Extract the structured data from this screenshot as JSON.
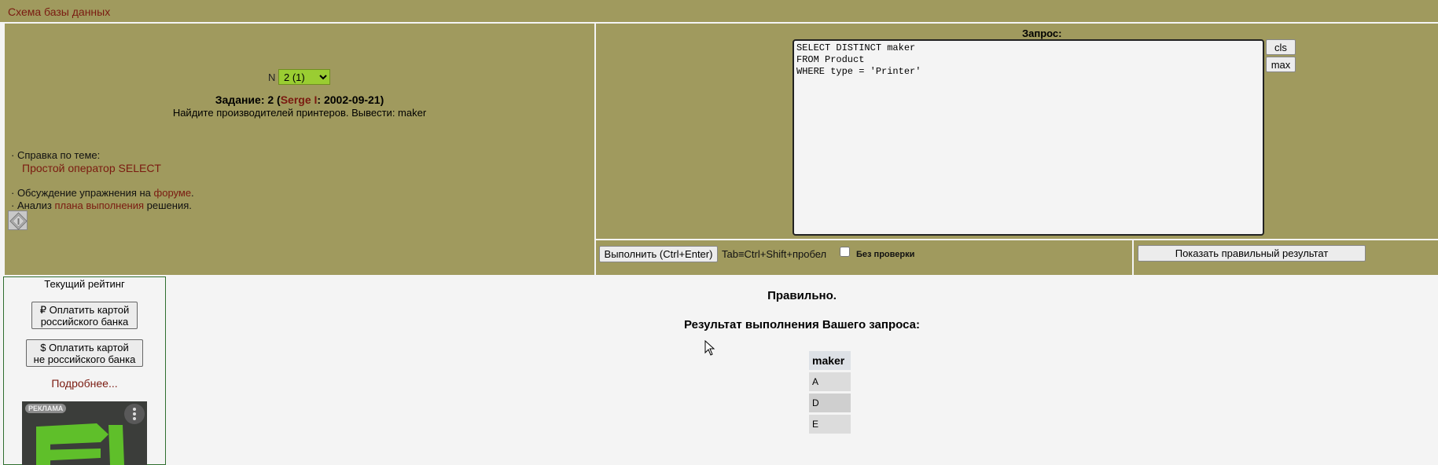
{
  "header": {
    "schema_link": "Схема базы данных"
  },
  "task": {
    "n_label": "N",
    "n_selected": "2 (1)",
    "title_prefix": "Задание: 2 (",
    "author": "Serge I",
    "title_suffix": ": 2002-09-21)",
    "description": "Найдите производителей принтеров. Вывести: maker",
    "help_label": "· Справка по теме:",
    "help_link": "Простой оператор SELECT",
    "forum_prefix": "· Обсуждение упражнения на ",
    "forum_link": "форуме",
    "forum_suffix": ".",
    "plan_prefix": "· Анализ ",
    "plan_link": "плана выполнения",
    "plan_suffix": " решения."
  },
  "query": {
    "label": "Запрос:",
    "sql": "SELECT DISTINCT maker\nFROM Product\nWHERE type = 'Printer'",
    "cls_label": "cls",
    "max_label": "max"
  },
  "actions": {
    "run_label": "Выполнить (Ctrl+Enter)",
    "tab_hint": "Tab≡Ctrl+Shift+пробел",
    "nocheck_label": "Без  проверки",
    "show_correct_label": "Показать правильный результат"
  },
  "sidebar": {
    "rating_label": "Текущий рейтинг",
    "pay_ru_line1": "₽ Оплатить картой",
    "pay_ru_line2": "российского банка",
    "pay_foreign_line1": "$ Оплатить картой",
    "pay_foreign_line2": "не российского банка",
    "more_link": "Подробнее...",
    "ad_badge": "РЕКЛАМА"
  },
  "result": {
    "status": "Правильно.",
    "title": "Результат выполнения Вашего запроса:",
    "columns": [
      "maker"
    ],
    "rows": [
      [
        "A"
      ],
      [
        "D"
      ],
      [
        "E"
      ]
    ]
  },
  "colors": {
    "panel": "#a09a5e",
    "link": "#7a1a10",
    "select_bg": "#9acd32",
    "sidebar_border": "#2f6e2f"
  }
}
